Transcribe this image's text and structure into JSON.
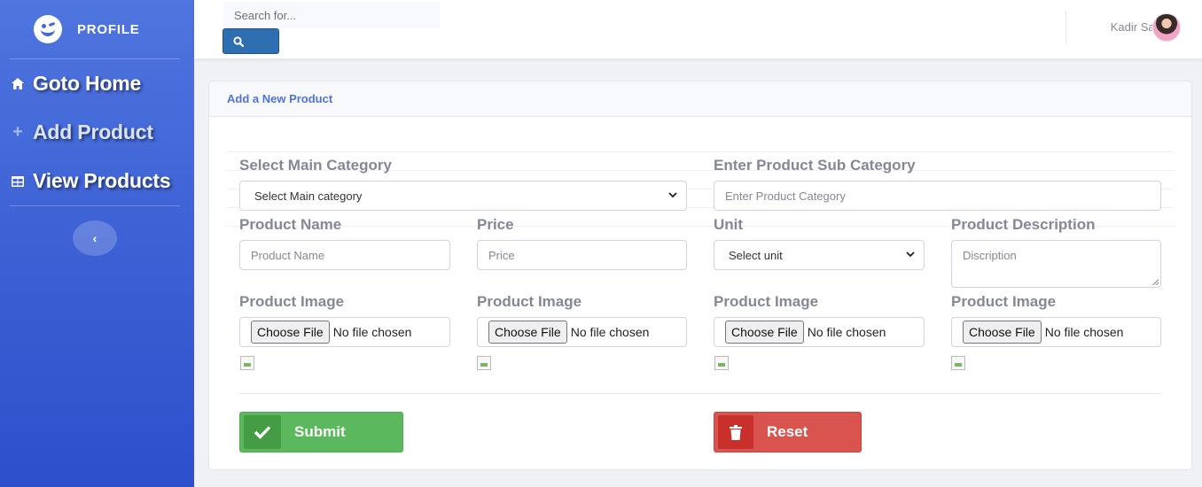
{
  "sidebar": {
    "brand_title": "PROFILE",
    "items": [
      {
        "label": "Goto Home",
        "icon": "home-icon"
      },
      {
        "label": "Add Product",
        "icon": "plus-icon"
      },
      {
        "label": "View Products",
        "icon": "table-icon"
      }
    ],
    "toggle_icon": "chevron-left-icon"
  },
  "topbar": {
    "search_placeholder": "Search for...",
    "user_name": "Kadir Saifi"
  },
  "card": {
    "title": "Add a New Product"
  },
  "form": {
    "main_category_label": "Select Main Category",
    "main_category_value": "Select Main category",
    "sub_category_label": "Enter Product Sub Category",
    "sub_category_placeholder": "Enter Product Category",
    "name_label": "Product Name",
    "name_placeholder": "Product Name",
    "price_label": "Price",
    "price_placeholder": "Price",
    "unit_label": "Unit",
    "unit_value": "Select unit",
    "description_label": "Product Description",
    "description_placeholder": "Discription",
    "images": [
      {
        "label": "Product Image",
        "button": "Choose File",
        "status": "No file chosen"
      },
      {
        "label": "Product Image",
        "button": "Choose File",
        "status": "No file chosen"
      },
      {
        "label": "Product Image",
        "button": "Choose File",
        "status": "No file chosen"
      },
      {
        "label": "Product Image",
        "button": "Choose File",
        "status": "No file chosen"
      }
    ],
    "submit_label": "Submit",
    "reset_label": "Reset"
  },
  "colors": {
    "sidebar": "#4e73df",
    "accent": "#4e73df",
    "submit": "#5cb85c",
    "reset": "#d9534f"
  }
}
